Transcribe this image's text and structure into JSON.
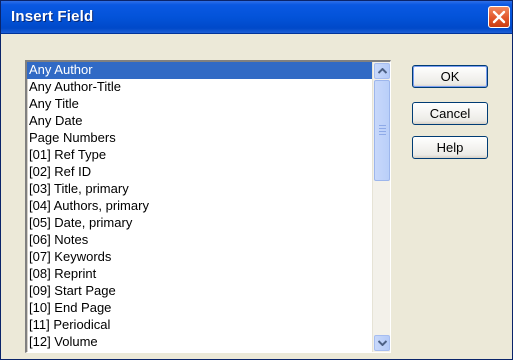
{
  "window": {
    "title": "Insert Field"
  },
  "icons": {
    "close": "close-icon",
    "scroll_up": "arrow-up-icon",
    "scroll_down": "arrow-down-icon"
  },
  "colors": {
    "titlebar": "#0353d9",
    "selection": "#316ac5",
    "dialog_bg": "#ece9d8",
    "close_button": "#e2562a"
  },
  "fields": {
    "selected_index": 0,
    "items": [
      "Any Author",
      "Any Author-Title",
      "Any Title",
      "Any Date",
      "Page Numbers",
      "[01] Ref Type",
      "[02] Ref ID",
      "[03] Title, primary",
      "[04] Authors, primary",
      "[05] Date, primary",
      "[06] Notes",
      "[07] Keywords",
      "[08] Reprint",
      "[09] Start Page",
      "[10] End Page",
      "[11] Periodical",
      "[12] Volume"
    ]
  },
  "buttons": {
    "ok": "OK",
    "cancel": "Cancel",
    "help": "Help"
  }
}
